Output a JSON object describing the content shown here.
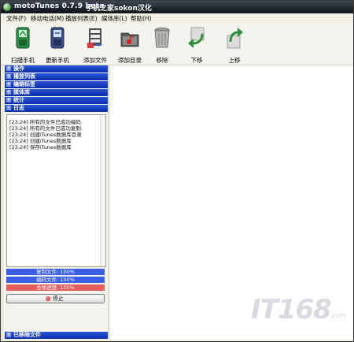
{
  "window": {
    "title": "motoTunes 0.7.9 beta",
    "title_extra": "手机之家sokon汉化"
  },
  "menu": [
    "文件(F)",
    "移动电话(M)",
    "播放列表(E)",
    "媒体库(L)",
    "帮助(H)"
  ],
  "toolbar": [
    {
      "label": "扫描手机",
      "icon": "phone-scan-icon"
    },
    {
      "label": "更新手机",
      "icon": "phone-update-icon"
    },
    {
      "label": "添加文件",
      "icon": "add-file-icon"
    },
    {
      "label": "添加目录",
      "icon": "add-folder-icon"
    },
    {
      "label": "移除",
      "icon": "trash-icon"
    },
    {
      "label": "下移",
      "icon": "move-down-icon"
    },
    {
      "label": "上移",
      "icon": "move-up-icon"
    }
  ],
  "sections": [
    "操作",
    "播放列表",
    "编辑标签",
    "媒体库",
    "统计",
    "日志"
  ],
  "log": [
    "[23:24] 所有的文件已成功编码.",
    "[23:24] 所有的文件已成功复制.",
    "[23:24] 创建iTunes数据库目录",
    "[23:24] 创建iTunes数据库",
    "[23:24] 保存iTunes数据库"
  ],
  "progress": [
    {
      "label": "复制文件: 100%",
      "value": 1.0,
      "color": "#3a5ee6"
    },
    {
      "label": "编码文件: 100%",
      "value": 1.0,
      "color": "#3a5ee6"
    },
    {
      "label": "总体进度: 100%",
      "value": 1.0,
      "color": "#e65a5a"
    }
  ],
  "stop_label": "停止",
  "removed_section": "已移除文件",
  "watermark": {
    "text": "IT168",
    "sub": ".com"
  }
}
